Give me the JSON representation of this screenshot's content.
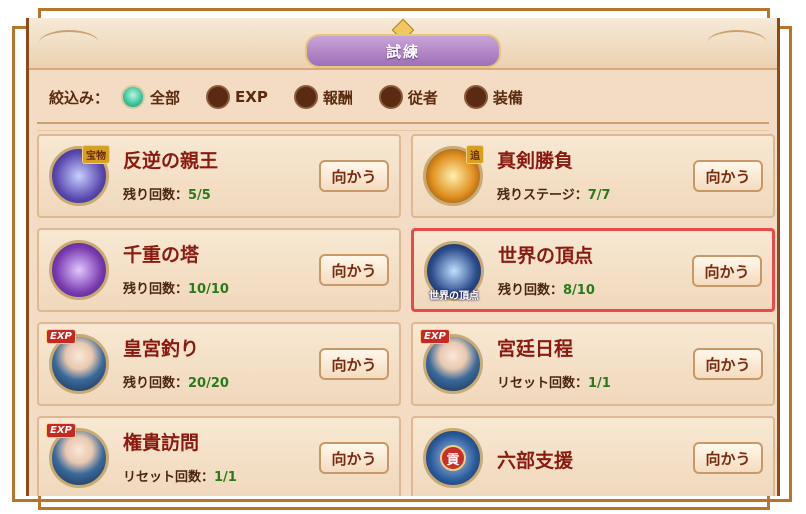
{
  "header": {
    "title": "試練"
  },
  "filter": {
    "label": "絞込み：",
    "options": [
      {
        "label": "全部",
        "selected": true
      },
      {
        "label": "EXP",
        "selected": false
      },
      {
        "label": "報酬",
        "selected": false
      },
      {
        "label": "従者",
        "selected": false
      },
      {
        "label": "装備",
        "selected": false
      }
    ]
  },
  "cards": [
    {
      "title": "反逆の親王",
      "sub_label": "残り回数：",
      "sub_value": "5/5",
      "tag": "宝物",
      "button": "向かう",
      "selected": false,
      "icon": "flower-orb-icon",
      "icon_color": "#5a4ab0"
    },
    {
      "title": "真剣勝負",
      "sub_label": "残りステージ：",
      "sub_value": "7/7",
      "tag": "追",
      "button": "向かう",
      "selected": false,
      "icon": "fire-orb-icon",
      "icon_color": "#e09020"
    },
    {
      "title": "千重の塔",
      "sub_label": "残り回数：",
      "sub_value": "10/10",
      "tag": "",
      "button": "向かう",
      "selected": false,
      "icon": "book-icon",
      "icon_color": "#7a3ab0"
    },
    {
      "title": "世界の頂点",
      "sub_label": "残り回数：",
      "sub_value": "8/10",
      "tag": "",
      "icon_caption": "世界の頂点",
      "button": "向かう",
      "selected": true,
      "icon": "pagoda-icon",
      "icon_color": "#2a4a8a"
    },
    {
      "title": "皇宮釣り",
      "sub_label": "残り回数：",
      "sub_value": "20/20",
      "tag": "EXP",
      "button": "向かう",
      "selected": false,
      "icon": "person-icon",
      "icon_color": "#3a6a9a"
    },
    {
      "title": "宮廷日程",
      "sub_label": "リセット回数：",
      "sub_value": "1/1",
      "tag": "EXP",
      "button": "向かう",
      "selected": false,
      "icon": "person-icon",
      "icon_color": "#3a6a9a"
    },
    {
      "title": "権貴訪問",
      "sub_label": "リセット回数：",
      "sub_value": "1/1",
      "tag": "EXP",
      "button": "向かう",
      "selected": false,
      "icon": "person-icon",
      "icon_color": "#3a6a9a"
    },
    {
      "title": "六部支援",
      "sub_label": "",
      "sub_value": "",
      "tag": "",
      "icon_caption": "貢",
      "button": "向かう",
      "selected": false,
      "icon": "tribute-bag-icon",
      "icon_color": "#2a5a9a"
    }
  ]
}
